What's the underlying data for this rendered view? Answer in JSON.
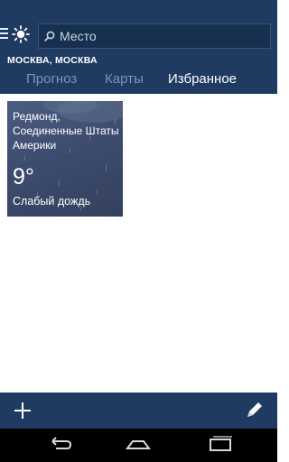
{
  "header": {
    "search": {
      "placeholder": "Место"
    },
    "location": "МОСКВА, МОСКВА",
    "tabs": [
      {
        "label": "Прогноз",
        "active": false
      },
      {
        "label": "Карты",
        "active": false
      },
      {
        "label": "Избранное",
        "active": true
      }
    ],
    "icons": [
      "menu-icon",
      "sun-icon",
      "search-icon"
    ]
  },
  "favorites": [
    {
      "city": "Редмонд, Соединенные Штаты Америки",
      "temperature": "9°",
      "condition": "Слабый дождь"
    }
  ],
  "appbar": {
    "icons": [
      "add-icon",
      "edit-pencil-icon"
    ]
  },
  "system_nav": {
    "icons": [
      "back-icon",
      "home-icon",
      "recents-icon"
    ]
  },
  "colors": {
    "header_bg": "#1f3b62",
    "tile_bg": "#3d4c6e",
    "tab_inactive": "#7f93ad",
    "tab_active": "#ffffff"
  }
}
